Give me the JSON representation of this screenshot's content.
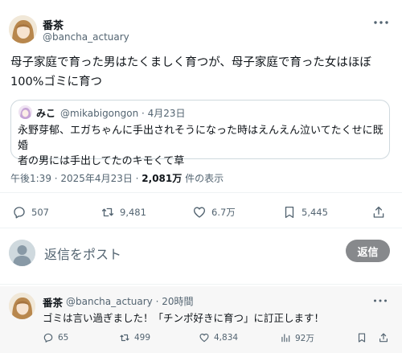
{
  "post": {
    "author": {
      "name": "番茶",
      "handle": "@bancha_actuary"
    },
    "text_line1": "母子家庭で育った男はたくましく育つが、母子家庭で育った女はほぼ",
    "text_line2": "100%ゴミに育つ",
    "quote": {
      "author": "みこ",
      "handle_date": "@mikabigongon · 4月23日",
      "text_line1": "永野芽郁、エガちゃんに手出されそうになった時はえんえん泣いてたくせに既婚",
      "text_line2": "者の男には手出してたのキモくて草"
    },
    "meta": {
      "time_date": "午後1:39 · 2025年4月23日 · ",
      "views": "2,081万",
      "views_suffix": " 件の表示"
    },
    "actions": {
      "replies": "507",
      "reposts": "9,481",
      "likes": "6.7万",
      "bookmarks": "5,445"
    }
  },
  "reply_compose": {
    "placeholder": "返信をポスト",
    "button_label": "返信"
  },
  "reply": {
    "author": {
      "name": "番茶",
      "handle_time": "@bancha_actuary · 20時間"
    },
    "text": "ゴミは言い過ぎました！「チンポ好きに育つ」に訂正します！",
    "actions": {
      "replies": "65",
      "reposts": "499",
      "likes": "4,834",
      "views": "92万"
    }
  },
  "icons": [
    "more-icon",
    "reply-icon",
    "repost-icon",
    "like-icon",
    "bookmark-icon",
    "share-icon",
    "views-icon"
  ]
}
